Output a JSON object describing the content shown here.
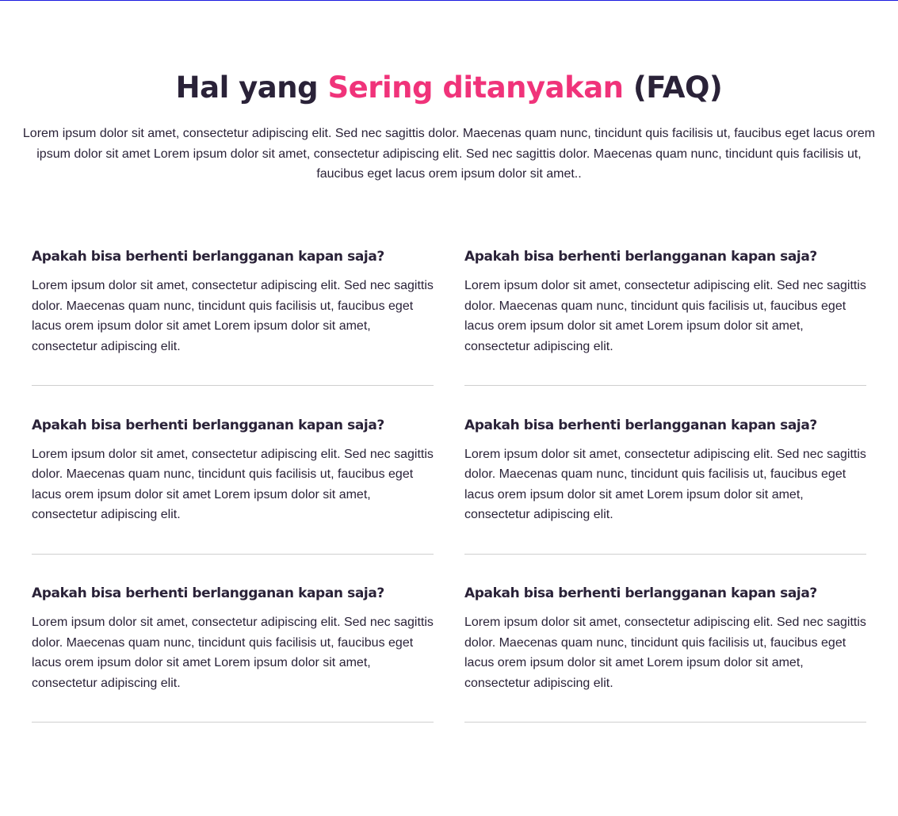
{
  "header": {
    "title_prefix": "Hal yang ",
    "title_accent": "Sering ditanyakan",
    "title_suffix": " (FAQ)",
    "intro": "Lorem ipsum dolor sit amet, consectetur adipiscing elit. Sed nec sagittis dolor. Maecenas quam nunc, tincidunt quis facilisis ut, faucibus eget lacus orem ipsum dolor sit amet Lorem ipsum dolor sit amet, consectetur adipiscing elit. Sed nec sagittis dolor. Maecenas quam nunc, tincidunt quis facilisis ut, faucibus eget lacus orem ipsum dolor sit amet.."
  },
  "colors": {
    "accent": "#f0337a",
    "text": "#2a2238",
    "divider": "#cfcfcf",
    "top_line": "#1a1ae0"
  },
  "faq": {
    "items": [
      {
        "question": "Apakah bisa berhenti berlangganan kapan saja?",
        "answer": "Lorem ipsum dolor sit amet, consectetur adipiscing elit. Sed nec sagittis dolor. Maecenas quam nunc, tincidunt quis facilisis ut, faucibus eget lacus orem ipsum dolor sit amet Lorem ipsum dolor sit amet, consectetur adipiscing elit."
      },
      {
        "question": "Apakah bisa berhenti berlangganan kapan saja?",
        "answer": "Lorem ipsum dolor sit amet, consectetur adipiscing elit. Sed nec sagittis dolor. Maecenas quam nunc, tincidunt quis facilisis ut, faucibus eget lacus orem ipsum dolor sit amet Lorem ipsum dolor sit amet, consectetur adipiscing elit."
      },
      {
        "question": "Apakah bisa berhenti berlangganan kapan saja?",
        "answer": "Lorem ipsum dolor sit amet, consectetur adipiscing elit. Sed nec sagittis dolor. Maecenas quam nunc, tincidunt quis facilisis ut, faucibus eget lacus orem ipsum dolor sit amet Lorem ipsum dolor sit amet, consectetur adipiscing elit."
      },
      {
        "question": "Apakah bisa berhenti berlangganan kapan saja?",
        "answer": "Lorem ipsum dolor sit amet, consectetur adipiscing elit. Sed nec sagittis dolor. Maecenas quam nunc, tincidunt quis facilisis ut, faucibus eget lacus orem ipsum dolor sit amet Lorem ipsum dolor sit amet, consectetur adipiscing elit."
      },
      {
        "question": "Apakah bisa berhenti berlangganan kapan saja?",
        "answer": "Lorem ipsum dolor sit amet, consectetur adipiscing elit. Sed nec sagittis dolor. Maecenas quam nunc, tincidunt quis facilisis ut, faucibus eget lacus orem ipsum dolor sit amet Lorem ipsum dolor sit amet, consectetur adipiscing elit."
      },
      {
        "question": "Apakah bisa berhenti berlangganan kapan saja?",
        "answer": "Lorem ipsum dolor sit amet, consectetur adipiscing elit. Sed nec sagittis dolor. Maecenas quam nunc, tincidunt quis facilisis ut, faucibus eget lacus orem ipsum dolor sit amet Lorem ipsum dolor sit amet, consectetur adipiscing elit."
      }
    ]
  }
}
